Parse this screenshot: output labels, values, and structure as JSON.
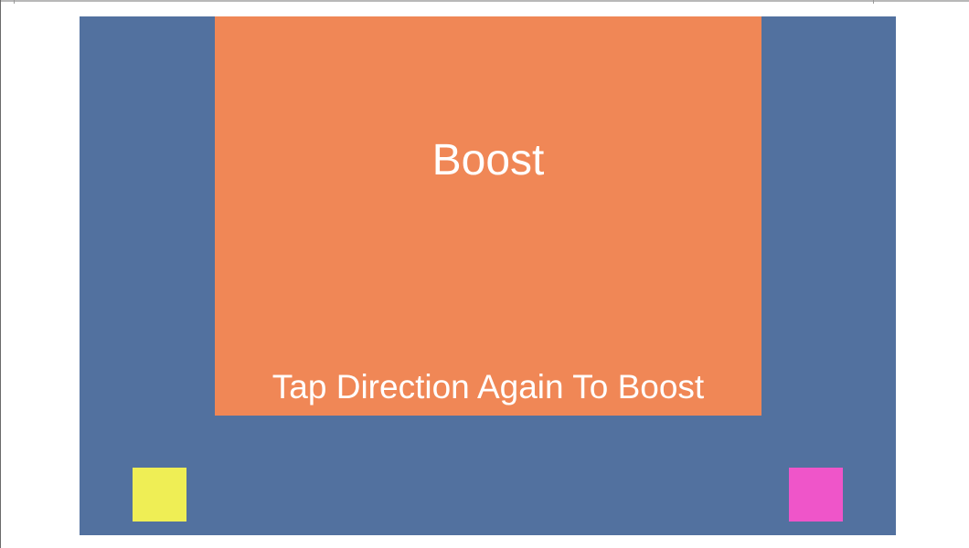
{
  "boost_panel": {
    "title": "Boost",
    "hint": "Tap Direction Again To Boost"
  },
  "players": [
    {
      "name": "yellow",
      "color": "#efee55"
    },
    {
      "name": "pink",
      "color": "#ef55c9"
    }
  ],
  "colors": {
    "background": "#52719f",
    "panel": "#f08756",
    "text": "#ffffff"
  }
}
